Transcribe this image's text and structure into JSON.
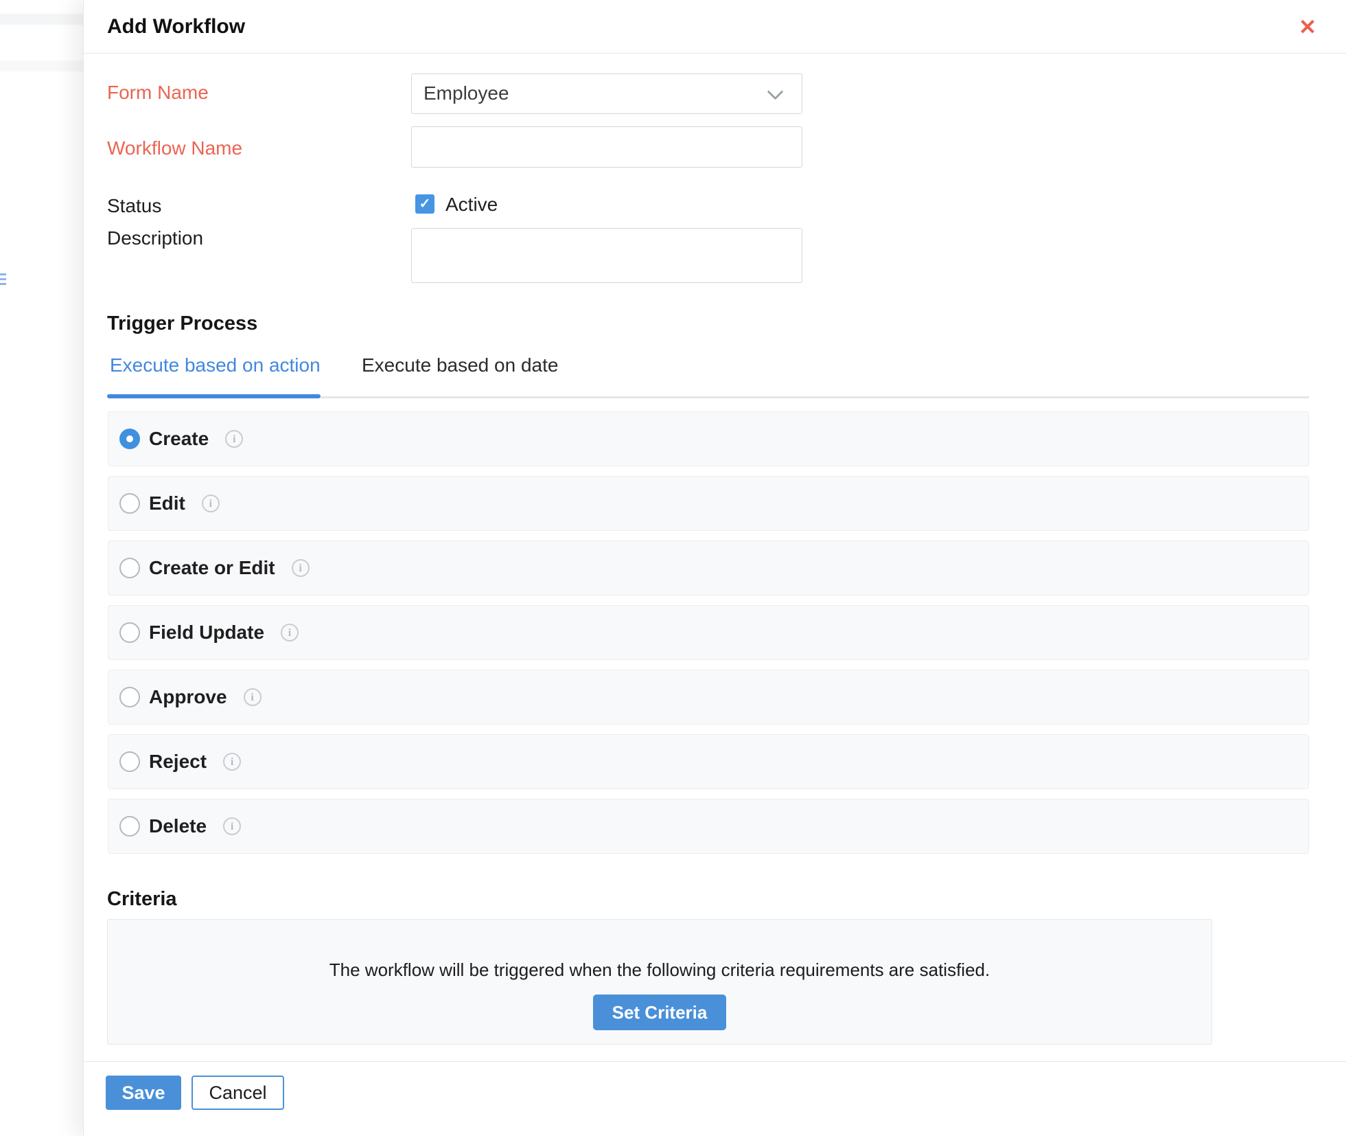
{
  "modal": {
    "title": "Add Workflow",
    "close_icon": "✕",
    "fields": {
      "form_name": {
        "label": "Form Name",
        "value": "Employee",
        "required": true
      },
      "workflow_name": {
        "label": "Workflow Name",
        "value": "",
        "required": true
      },
      "status": {
        "label": "Status",
        "checkbox_label": "Active",
        "checked": true,
        "check_glyph": "✓"
      },
      "description": {
        "label": "Description",
        "value": ""
      }
    },
    "trigger": {
      "heading": "Trigger Process",
      "tabs": [
        {
          "label": "Execute based on action",
          "active": true
        },
        {
          "label": "Execute based on date",
          "active": false
        }
      ],
      "options": [
        {
          "label": "Create",
          "selected": true,
          "info": "i"
        },
        {
          "label": "Edit",
          "selected": false,
          "info": "i"
        },
        {
          "label": "Create or Edit",
          "selected": false,
          "info": "i"
        },
        {
          "label": "Field Update",
          "selected": false,
          "info": "i"
        },
        {
          "label": "Approve",
          "selected": false,
          "info": "i"
        },
        {
          "label": "Reject",
          "selected": false,
          "info": "i"
        },
        {
          "label": "Delete",
          "selected": false,
          "info": "i"
        }
      ]
    },
    "criteria": {
      "heading": "Criteria",
      "message": "The workflow will be triggered when the following criteria requirements are satisfied.",
      "set_button": "Set Criteria"
    },
    "footer": {
      "save": "Save",
      "cancel": "Cancel"
    }
  },
  "colors": {
    "required_label": "#ea6552",
    "primary_button": "#4a90d9",
    "active_tab": "#4287e0",
    "checkbox": "#4696e4",
    "radio_selected": "#4090e0",
    "close_icon": "#e8604c"
  }
}
